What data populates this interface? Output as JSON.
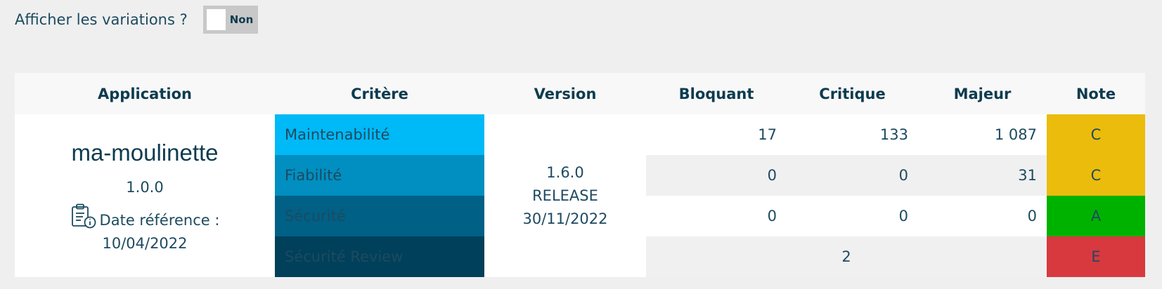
{
  "toggle": {
    "label": "Afficher les variations ?",
    "state": "Non"
  },
  "table": {
    "headers": [
      "Application",
      "Critère",
      "Version",
      "Bloquant",
      "Critique",
      "Majeur",
      "Note"
    ],
    "app": {
      "name": "ma-moulinette",
      "version": "1.0.0",
      "date_label": "Date référence :",
      "date_value": "10/04/2022",
      "icon": "clipboard-info-icon"
    },
    "version": {
      "number": "1.6.0",
      "type": "RELEASE",
      "date": "30/11/2022"
    },
    "rows": [
      {
        "critere": "Maintenabilité",
        "bloquant": "17",
        "critique": "133",
        "majeur": "1 087",
        "note": "C"
      },
      {
        "critere": "Fiabilité",
        "bloquant": "0",
        "critique": "0",
        "majeur": "31",
        "note": "C"
      },
      {
        "critere": "Sécurité",
        "bloquant": "0",
        "critique": "0",
        "majeur": "0",
        "note": "A"
      },
      {
        "critere": "Sécurité Review",
        "merged_value": "2",
        "note": "E"
      }
    ]
  },
  "colors": {
    "note_C": "#ebbc0c",
    "note_A": "#00b200",
    "note_E": "#d8393f",
    "critere_shades": [
      "#00b9f7",
      "#008fc0",
      "#006085",
      "#00405a"
    ]
  }
}
